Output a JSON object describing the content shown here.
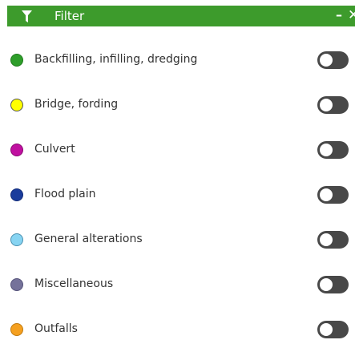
{
  "header": {
    "title": "Filter",
    "background": "#3d9b2c",
    "filter_icon": "funnel-icon",
    "minimize_label": "–",
    "close_label": "✕"
  },
  "categories": [
    {
      "label": "Backfilling, infilling, dredging",
      "color": "#2e9e2a",
      "border": "#1f7a1d",
      "enabled": false
    },
    {
      "label": "Bridge, fording",
      "color": "#ffff00",
      "border": "#555555",
      "enabled": false
    },
    {
      "label": "Culvert",
      "color": "#c010a0",
      "border": "#8a0a72",
      "enabled": false
    },
    {
      "label": "Flood plain",
      "color": "#1a3c9c",
      "border": "#122c78",
      "enabled": false
    },
    {
      "label": "General alterations",
      "color": "#87d4f2",
      "border": "#4a90b0",
      "enabled": false
    },
    {
      "label": "Miscellaneous",
      "color": "#75729a",
      "border": "#55537a",
      "enabled": false
    },
    {
      "label": "Outfalls",
      "color": "#f5a020",
      "border": "#c07a10",
      "enabled": false
    }
  ],
  "toggle_color": "#484848"
}
